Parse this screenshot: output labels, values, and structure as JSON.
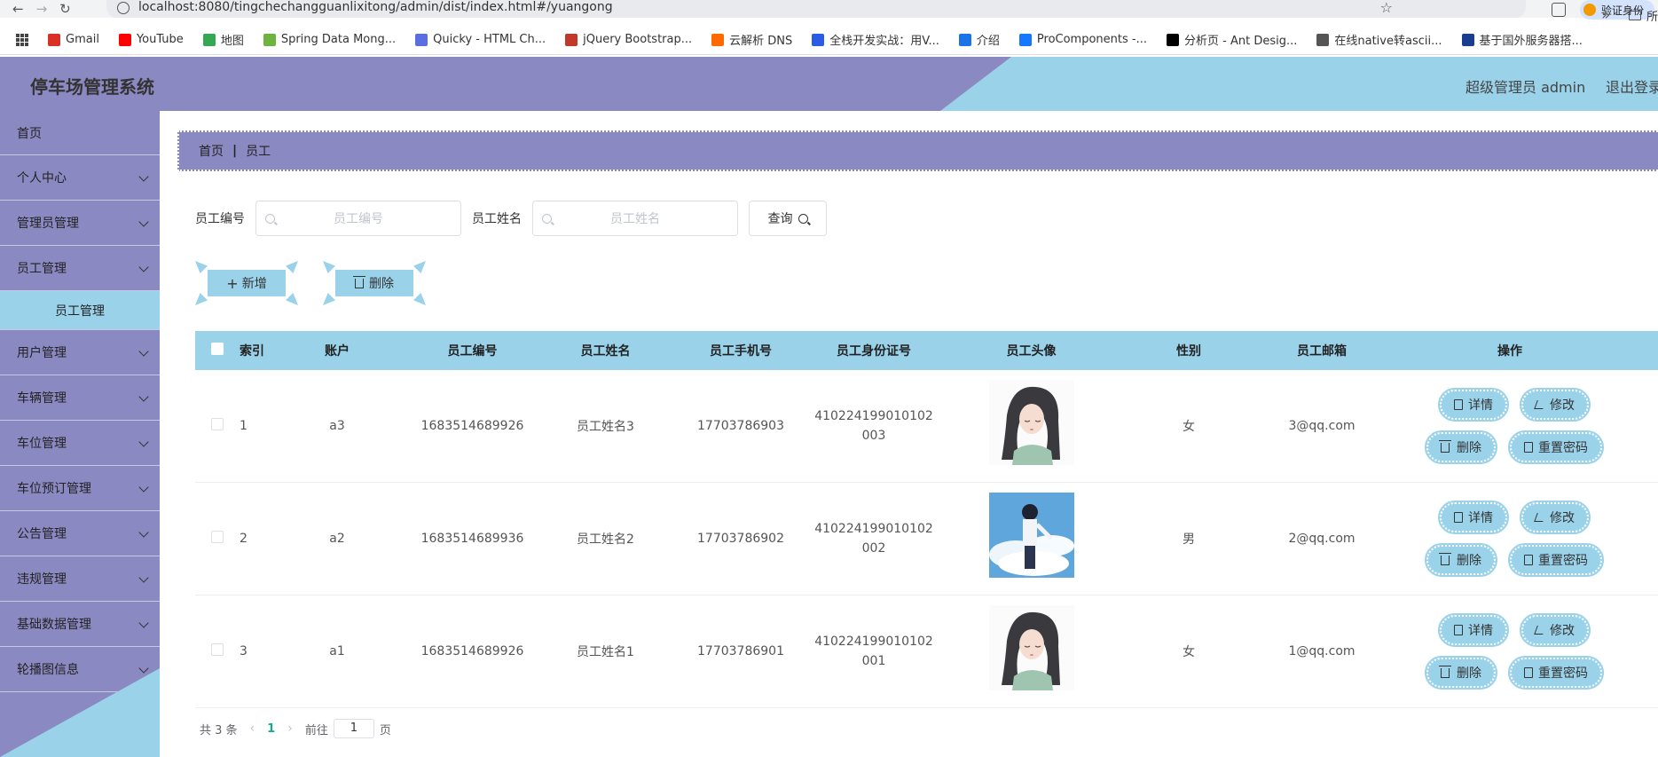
{
  "browser": {
    "url": "localhost:8080/tingchechangguanlixitong/admin/dist/index.html#/yuangong",
    "verify_label": "验证身份",
    "bookmarks": [
      {
        "label": "Gmail",
        "color": "#d93025"
      },
      {
        "label": "YouTube",
        "color": "#ff0000"
      },
      {
        "label": "地图",
        "color": "#34a853"
      },
      {
        "label": "Spring Data Mong...",
        "color": "#6db33f"
      },
      {
        "label": "Quicky - HTML Ch...",
        "color": "#5b6ee1"
      },
      {
        "label": "jQuery Bootstrap...",
        "color": "#c0392b"
      },
      {
        "label": "云解析 DNS",
        "color": "#ff6a00"
      },
      {
        "label": "全栈开发实战：用V...",
        "color": "#2b5ce6"
      },
      {
        "label": "介绍",
        "color": "#1a73e8"
      },
      {
        "label": "ProComponents -...",
        "color": "#1677ff"
      },
      {
        "label": "分析页 - Ant Desig...",
        "color": "#000000"
      },
      {
        "label": "在线native转ascii...",
        "color": "#555555"
      },
      {
        "label": "基于国外服务器搭...",
        "color": "#1a3d8f"
      }
    ],
    "bookmarks_folder": "所"
  },
  "header": {
    "title": "停车场管理系统",
    "user": "超级管理员 admin",
    "logout": "退出登录"
  },
  "sidebar": {
    "items": [
      {
        "label": "首页",
        "chevron": false
      },
      {
        "label": "个人中心",
        "chevron": true
      },
      {
        "label": "管理员管理",
        "chevron": true
      },
      {
        "label": "员工管理",
        "chevron": true
      },
      {
        "label": "用户管理",
        "chevron": true
      },
      {
        "label": "车辆管理",
        "chevron": true
      },
      {
        "label": "车位管理",
        "chevron": true
      },
      {
        "label": "车位预订管理",
        "chevron": true
      },
      {
        "label": "公告管理",
        "chevron": true
      },
      {
        "label": "违规管理",
        "chevron": true
      },
      {
        "label": "基础数据管理",
        "chevron": true
      },
      {
        "label": "轮播图信息",
        "chevron": true
      }
    ],
    "submenu_active": "员工管理"
  },
  "breadcrumb": {
    "home": "首页",
    "current": "员工"
  },
  "search": {
    "no_label": "员工编号",
    "no_placeholder": "员工编号",
    "name_label": "员工姓名",
    "name_placeholder": "员工姓名",
    "query_label": "查询"
  },
  "toolbar": {
    "add_label": "新增",
    "delete_label": "删除"
  },
  "table": {
    "headers": [
      "索引",
      "账户",
      "员工编号",
      "员工姓名",
      "员工手机号",
      "员工身份证号",
      "员工头像",
      "性别",
      "员工邮箱",
      "操作"
    ],
    "rows": [
      {
        "index": "1",
        "account": "a3",
        "no": "1683514689926",
        "name": "员工姓名3",
        "phone": "17703786903",
        "id_line1": "410224199010102",
        "id_line2": "003",
        "avatar": "girl",
        "sex": "女",
        "email": "3@qq.com"
      },
      {
        "index": "2",
        "account": "a2",
        "no": "1683514689936",
        "name": "员工姓名2",
        "phone": "17703786902",
        "id_line1": "410224199010102",
        "id_line2": "002",
        "avatar": "boy",
        "sex": "男",
        "email": "2@qq.com"
      },
      {
        "index": "3",
        "account": "a1",
        "no": "1683514689926",
        "name": "员工姓名1",
        "phone": "17703786901",
        "id_line1": "410224199010102",
        "id_line2": "001",
        "avatar": "girl",
        "sex": "女",
        "email": "1@qq.com"
      }
    ],
    "ops": {
      "detail": "详情",
      "edit": "修改",
      "delete": "删除",
      "reset": "重置密码"
    }
  },
  "pager": {
    "total": "共 3 条",
    "page": "1",
    "goto": "前往",
    "goto_value": "1",
    "unit": "页"
  },
  "colors": {
    "purple": "#8b89c2",
    "blue": "#9ad2ea",
    "active_page": "#13a892"
  }
}
